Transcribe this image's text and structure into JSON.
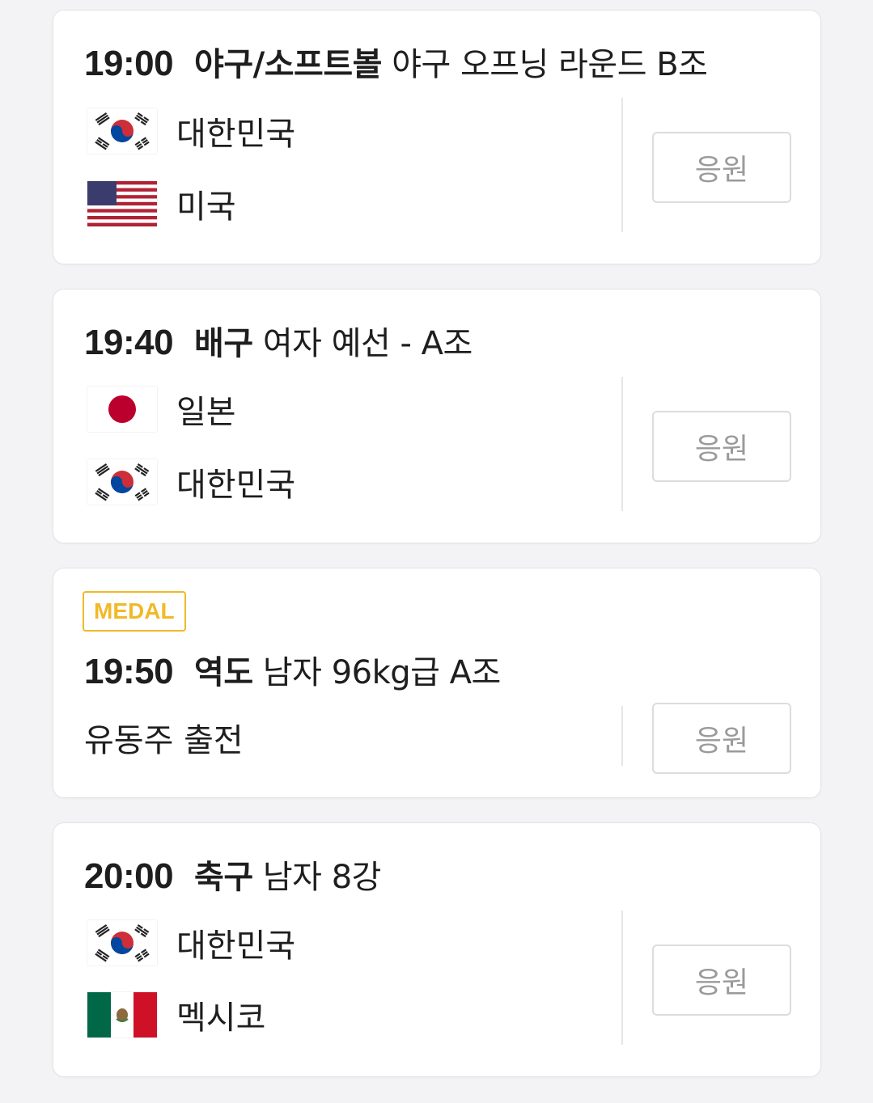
{
  "cheer_label": "응원",
  "colors": {
    "medal": "#f1b928",
    "card_border": "#e3e3e6",
    "button_text": "#9a9a9a"
  },
  "matches": [
    {
      "time": "19:00",
      "sport": "야구/소프트볼",
      "detail": "야구 오프닝 라운드 B조",
      "teams": [
        {
          "name": "대한민국",
          "flag": "korea-flag-icon"
        },
        {
          "name": "미국",
          "flag": "usa-flag-icon"
        }
      ]
    },
    {
      "time": "19:40",
      "sport": "배구",
      "detail": "여자 예선 - A조",
      "teams": [
        {
          "name": "일본",
          "flag": "japan-flag-icon"
        },
        {
          "name": "대한민국",
          "flag": "korea-flag-icon"
        }
      ]
    },
    {
      "badge": "MEDAL",
      "time": "19:50",
      "sport": "역도",
      "detail": "남자 96kg급 A조",
      "note": "유동주 출전"
    },
    {
      "time": "20:00",
      "sport": "축구",
      "detail": "남자 8강",
      "teams": [
        {
          "name": "대한민국",
          "flag": "korea-flag-icon"
        },
        {
          "name": "멕시코",
          "flag": "mexico-flag-icon"
        }
      ]
    }
  ]
}
